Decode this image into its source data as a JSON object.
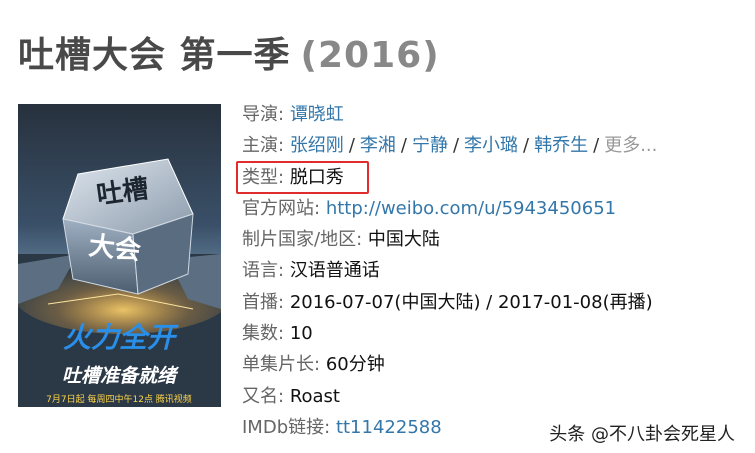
{
  "title": {
    "name": "吐槽大会 第一季",
    "year": "(2016)"
  },
  "poster": {
    "logo_line1": "吐槽",
    "logo_line2": "大会",
    "slogan_line1": "火力全开",
    "slogan_line2": "吐槽准备就绪",
    "bottom_text": "7月7日起 每周四中午12点 腾讯视频"
  },
  "info": {
    "director": {
      "label": "导演:",
      "value": "谭晓虹"
    },
    "cast": {
      "label": "主演:",
      "names": [
        "张绍刚",
        "李湘",
        "宁静",
        "李小璐",
        "韩乔生"
      ],
      "more": "更多..."
    },
    "genre": {
      "label": "类型:",
      "value": "脱口秀"
    },
    "website": {
      "label": "官方网站:",
      "value": "http://weibo.com/u/5943450651"
    },
    "country": {
      "label": "制片国家/地区:",
      "value": "中国大陆"
    },
    "language": {
      "label": "语言:",
      "value": "汉语普通话"
    },
    "premiere": {
      "label": "首播:",
      "value": "2016-07-07(中国大陆) / 2017-01-08(再播)"
    },
    "episodes": {
      "label": "集数:",
      "value": "10"
    },
    "runtime": {
      "label": "单集片长:",
      "value": "60分钟"
    },
    "aka": {
      "label": "又名:",
      "value": "Roast"
    },
    "imdb": {
      "label": "IMDb链接:",
      "value": "tt11422588"
    }
  },
  "watermark": "头条 @不八卦会死星人",
  "colors": {
    "link": "#3377aa",
    "highlight": "#e02c2c",
    "title": "#494949"
  }
}
